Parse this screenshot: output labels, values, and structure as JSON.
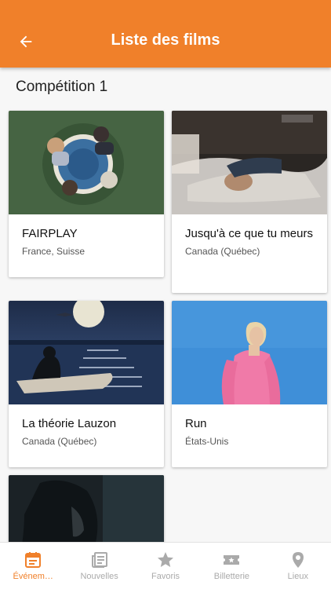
{
  "header": {
    "title": "Liste des films",
    "back_icon": "arrow-left-icon"
  },
  "section": {
    "title": "Compétition 1"
  },
  "films": [
    {
      "title": "FAIRPLAY",
      "country": "France, Suisse"
    },
    {
      "title": "Jusqu'à ce que tu meurs",
      "country": "Canada (Québec)"
    },
    {
      "title": "La théorie Lauzon",
      "country": "Canada (Québec)"
    },
    {
      "title": "Run",
      "country": "États-Unis"
    }
  ],
  "nav": {
    "items": [
      {
        "label": "Événem…",
        "icon": "calendar-icon",
        "active": true
      },
      {
        "label": "Nouvelles",
        "icon": "news-icon",
        "active": false
      },
      {
        "label": "Favoris",
        "icon": "star-icon",
        "active": false
      },
      {
        "label": "Billetterie",
        "icon": "ticket-icon",
        "active": false
      },
      {
        "label": "Lieux",
        "icon": "location-pin-icon",
        "active": false
      }
    ]
  },
  "colors": {
    "accent": "#f0802a",
    "inactive": "#aaaaaa"
  }
}
